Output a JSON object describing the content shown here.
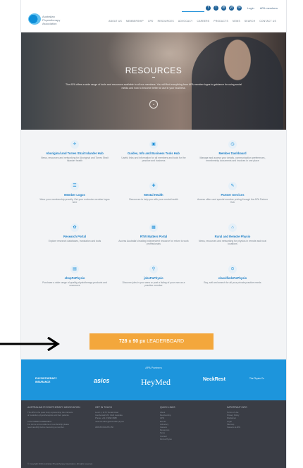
{
  "header": {
    "logo_text": "Australian Physiotherapy Association",
    "social_icons": [
      "f",
      "t",
      "in",
      "yt",
      "✉"
    ],
    "login": "Login",
    "member_link": "APA members",
    "nav": [
      "ABOUT US",
      "MEMBERSHIP",
      "CPD",
      "RESOURCES",
      "ADVOCACY",
      "CAREERS",
      "PRODUCTS",
      "NEWS",
      "SEARCH",
      "CONTACT US"
    ]
  },
  "hero": {
    "title": "RESOURCES",
    "subtitle": "The APA offers a wide range of tools and resources available to all our members. You will find everything from APA member logos to guidance for using social media and how to become better at use in your business."
  },
  "cards": [
    {
      "icon": "✈",
      "title": "Aboriginal and Torres Strait Islander Hub",
      "desc": "News, resources and networking for Aboriginal and Torres Strait Islander health"
    },
    {
      "icon": "▣",
      "title": "Guides, Info and Business Tools Hub",
      "desc": "Useful links and information for all members and tools for the practice and business"
    },
    {
      "icon": "◷",
      "title": "Member Dashboard",
      "desc": "Manage and access your details, communication preferences, membership documents and invoices in one place"
    },
    {
      "icon": "☰",
      "title": "Member Logos",
      "desc": "Wear your membership proudly. Get your exclusive member logos here"
    },
    {
      "icon": "✚",
      "title": "Mental Health",
      "desc": "Resources to help you with your mental health"
    },
    {
      "icon": "✎",
      "title": "Partner Services",
      "desc": "Access offers and special member pricing through the APA Partner Hub"
    },
    {
      "icon": "✿",
      "title": "Research Portal",
      "desc": "Explore research databases, translation and tools"
    },
    {
      "icon": "▦",
      "title": "RTW Matters Portal",
      "desc": "Access Australia's leading independent resource for return to work professionals"
    },
    {
      "icon": "⌂",
      "title": "Rural and Remote Physio",
      "desc": "News, resources and networking for physios in remote and rural locations"
    },
    {
      "icon": "▤",
      "title": "shopPaPhysio",
      "desc": "Purchase a wide range of quality physiotherapy products and resources"
    },
    {
      "icon": "⚲",
      "title": "jobsPaPhysio",
      "desc": "Discover jobs in your area or post a listing of your own as a practice member"
    },
    {
      "icon": "⊙",
      "title": "classifiedsPaPhysio",
      "desc": "Buy, sell and search for all your private practice needs"
    }
  ],
  "leaderboard": {
    "size": "728 x 90 px",
    "label": "LEADERBOARD"
  },
  "partners": {
    "title": "APA Partners",
    "logos": [
      "PHYSIOTHERAPY INSURANCE",
      "asics",
      "HeyMed",
      "NeckRest",
      "The Physio Co"
    ]
  },
  "footer": {
    "col1_head": "AUSTRALIAN PHYSIOTHERAPY ASSOCIATION",
    "col1_lines": [
      "The APA is the peak body representing the interests",
      "of Australian physiotherapists and their patients.",
      "",
      "CUSTOMER AGREEMENT",
      "For terms and conditions of membership please",
      "read carefully before becoming a member."
    ],
    "col2_head": "GET IN TOUCH",
    "col2_lines": [
      "Level 1, 1175 Toorak Road",
      "Camberwell VIC 3124 Australia",
      "Phone: +61 3 9092 0888",
      "national.office@australian.physio",
      "",
      "ABN 89 004 265 150"
    ],
    "col3_head": "QUICK LINKS",
    "col3_lines": [
      "About",
      "Membership",
      "CPD",
      "Events",
      "Advocacy",
      "Careers",
      "Resources",
      "News",
      "Contact",
      "Find a Physio"
    ],
    "col4_head": "IMPORTANT INFO",
    "col4_lines": [
      "Terms of Use",
      "Privacy Policy",
      "Disclaimer",
      "Legal",
      "Sitemap",
      "Careers at APA"
    ],
    "copyright": "© Copyright 2019 Australian Physiotherapy Association. All rights reserved."
  }
}
